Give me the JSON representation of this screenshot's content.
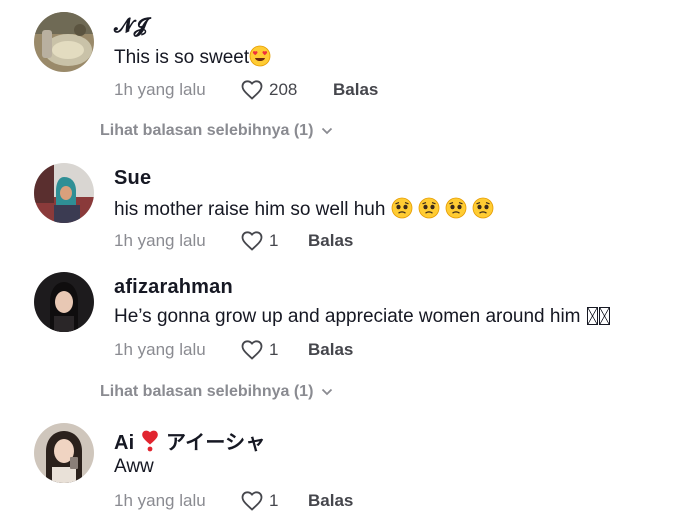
{
  "comments": [
    {
      "username": "𝓝𝓙",
      "text": "This is so sweet",
      "text_emoji": [
        "heart-eyes-emoji"
      ],
      "time": "1h yang lalu",
      "likes": "208",
      "reply_label": "Balas"
    },
    {
      "username": "Sue",
      "text": "his mother raise him so well huh",
      "text_emoji": [
        "pleading-face-emoji",
        "pleading-face-emoji",
        "pleading-face-emoji",
        "pleading-face-emoji"
      ],
      "time": "1h yang lalu",
      "likes": "1",
      "reply_label": "Balas"
    },
    {
      "username": "afizarahman",
      "text": "He’s gonna grow up and appreciate women around him",
      "time": "1h yang lalu",
      "likes": "1",
      "reply_label": "Balas"
    },
    {
      "username_prefix": "Ai",
      "username_suffix": "アイーシャ",
      "username_icon": "red-heart-exclamation-icon",
      "text": "Aww",
      "time": "1h yang lalu",
      "likes": "1",
      "reply_label": "Balas"
    }
  ],
  "view_more_label": "Lihat balasan selebihnya (1)",
  "icons": {
    "like": "heart-outline-icon",
    "view_more": "chevron-down-icon"
  },
  "colors": {
    "text": "#161823",
    "muted": "#8a8b91",
    "meta": "#45464c",
    "accent_red": "#fe2c55"
  }
}
